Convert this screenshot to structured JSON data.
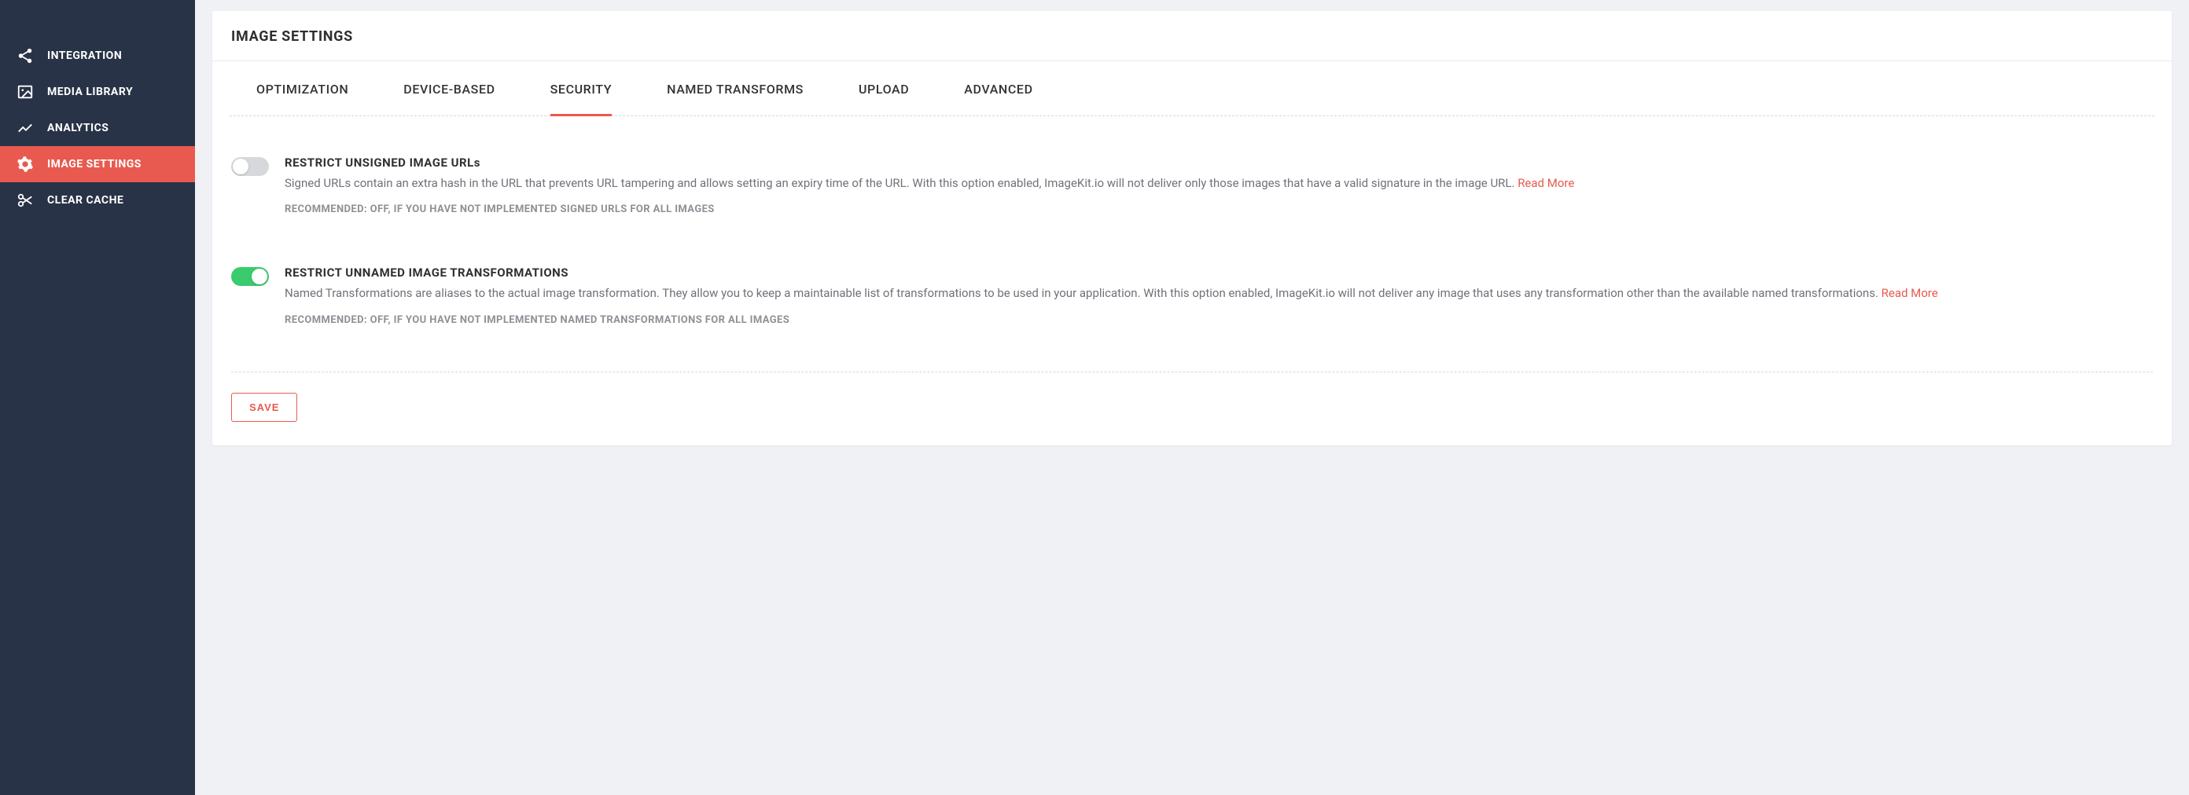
{
  "sidebar": {
    "items": [
      {
        "label": "INTEGRATION",
        "icon": "share-icon",
        "active": false
      },
      {
        "label": "MEDIA LIBRARY",
        "icon": "image-icon",
        "active": false
      },
      {
        "label": "ANALYTICS",
        "icon": "chart-icon",
        "active": false
      },
      {
        "label": "IMAGE SETTINGS",
        "icon": "gear-icon",
        "active": true
      },
      {
        "label": "CLEAR CACHE",
        "icon": "scissors-icon",
        "active": false
      }
    ]
  },
  "panel": {
    "title": "IMAGE SETTINGS"
  },
  "tabs": [
    {
      "label": "OPTIMIZATION",
      "active": false
    },
    {
      "label": "DEVICE-BASED",
      "active": false
    },
    {
      "label": "SECURITY",
      "active": true
    },
    {
      "label": "NAMED TRANSFORMS",
      "active": false
    },
    {
      "label": "UPLOAD",
      "active": false
    },
    {
      "label": "ADVANCED",
      "active": false
    }
  ],
  "settings": [
    {
      "title": "RESTRICT UNSIGNED IMAGE URLs",
      "enabled": false,
      "description": "Signed URLs contain an extra hash in the URL that prevents URL tampering and allows setting an expiry time of the URL. With this option enabled, ImageKit.io will not deliver only those images that have a valid signature in the image URL.",
      "read_more": "Read More",
      "recommended": "RECOMMENDED: OFF, IF YOU HAVE NOT IMPLEMENTED SIGNED URLS FOR ALL IMAGES"
    },
    {
      "title": "RESTRICT UNNAMED IMAGE TRANSFORMATIONS",
      "enabled": true,
      "description": "Named Transformations are aliases to the actual image transformation. They allow you to keep a maintainable list of transformations to be used in your application. With this option enabled, ImageKit.io will not deliver any image that uses any transformation other than the available named transformations.",
      "read_more": "Read More",
      "recommended": "RECOMMENDED: OFF, IF YOU HAVE NOT IMPLEMENTED NAMED TRANSFORMATIONS FOR ALL IMAGES"
    }
  ],
  "save_button": "SAVE"
}
